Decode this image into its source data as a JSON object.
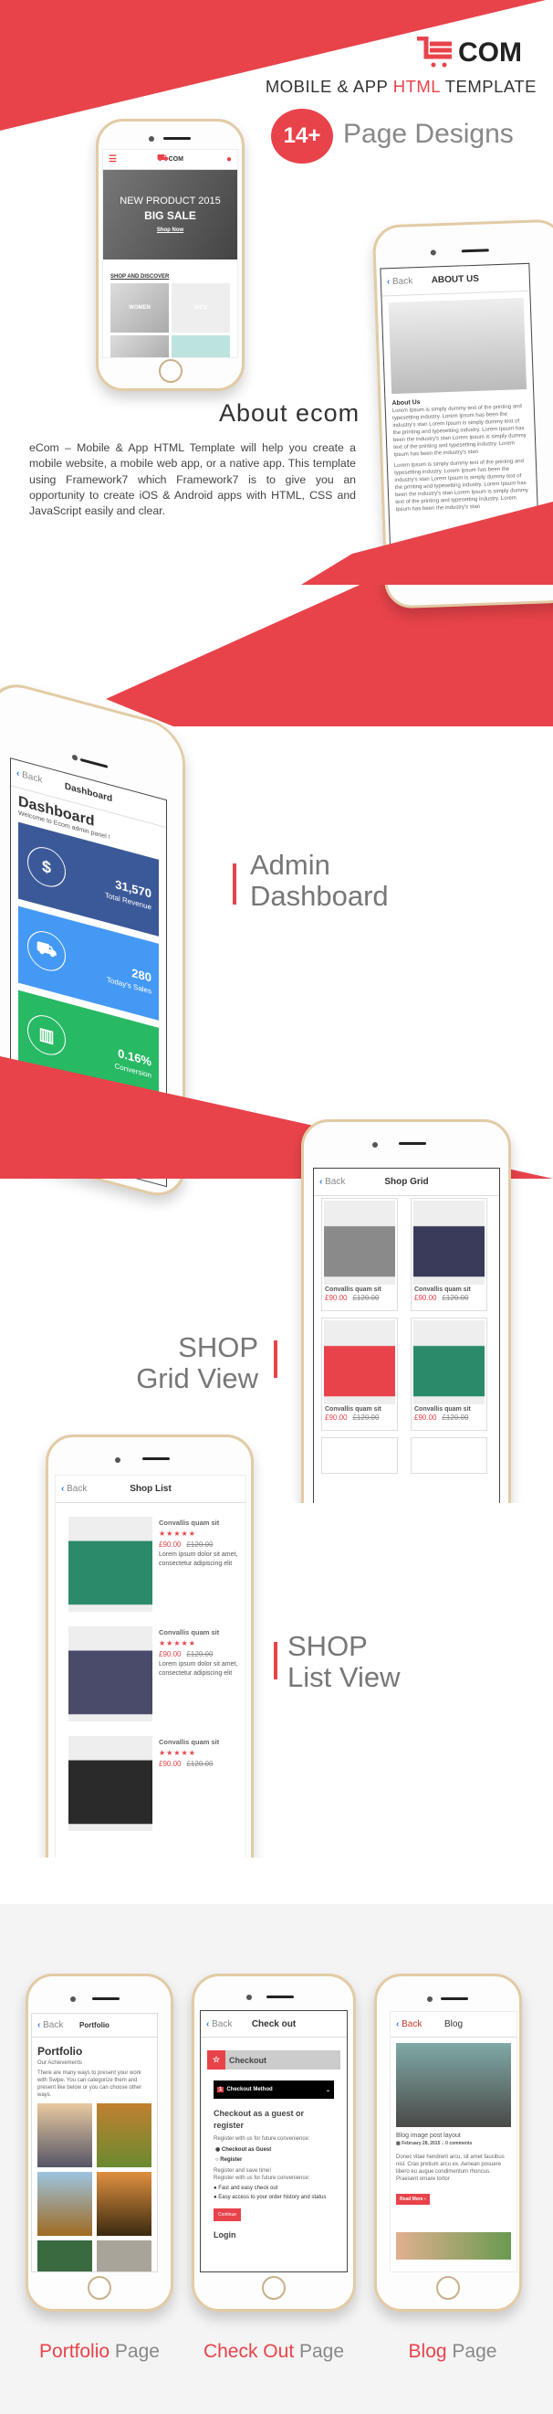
{
  "colors": {
    "accent": "#e8434a",
    "dark": "#222222",
    "blue": "#2a7bf5",
    "revenue": "#3b5998",
    "sales": "#4499f5",
    "conversion": "#28b964"
  },
  "logo": {
    "text": "COM",
    "icon": "cart-e-logo-icon"
  },
  "header": {
    "subtitle_pre": "MOBILE & APP ",
    "subtitle_accent": "HTML",
    "subtitle_post": " TEMPLATE",
    "badge": "14+",
    "badge_text": "Page Designs"
  },
  "home_phone": {
    "logo": "COM",
    "banner_line1": "NEW PRODUCT 2015",
    "banner_line2": "BIG SALE",
    "banner_button": "Shop Now",
    "section": "SHOP AND DISCOVER",
    "tiles": [
      "WOMEN",
      "MEN"
    ]
  },
  "about_phone": {
    "back": "Back",
    "title": "ABOUT US",
    "heading": "About Us",
    "para1": "Lorem Ipsum is simply dummy text of the printing and typesetting industry. Lorem Ipsum has been the industry's stan Lorem Ipsum is simply dummy text of the printing and typesetting industry. Lorem Ipsum has been the industry's stan Lorem Ipsum is simply dummy text of the printing and typesetting industry. Lorem Ipsum has been the industry's stan",
    "para2": "Lorem Ipsum is simply dummy text of the printing and typesetting industry. Lorem Ipsum has been the industry's stan Lorem Ipsum is simply dummy text of the printing and typesetting industry. Lorem Ipsum has been the industry's stan Lorem Ipsum is simply dummy text of the printing and typesetting industry. Lorem Ipsum has been the industry's stan"
  },
  "about": {
    "title": "About ecom",
    "text": "eCom – Mobile & App HTML Template will help you create a mobile website, a mobile web app, or a native app. This template using Framework7 which Framework7 is to give you an opportunity to create iOS & Android apps with HTML, CSS and JavaScript easily and clear."
  },
  "dashboard_phone": {
    "back": "Back",
    "title": "Dashboard",
    "heading": "Dashboard",
    "welcome": "Welcome to Ecom admin panel !",
    "stats": [
      {
        "value": "31,570",
        "label": "Total Revenue",
        "icon": "dollar-icon"
      },
      {
        "value": "280",
        "label": "Today's Sales",
        "icon": "cart-icon"
      },
      {
        "value": "0.16%",
        "label": "Conversion",
        "icon": "bar-chart-icon"
      }
    ]
  },
  "dashboard_label": {
    "line1": "Admin",
    "line2": "Dashboard"
  },
  "grid_phone": {
    "back": "Back",
    "title": "Shop Grid",
    "items": [
      {
        "name": "Convallis quam sit",
        "price": "£90.00",
        "old": "£120.00"
      },
      {
        "name": "Convallis quam sit",
        "price": "£90.00",
        "old": "£120.00"
      },
      {
        "name": "Convallis quam sit",
        "price": "£90.00",
        "old": "£120.00"
      },
      {
        "name": "Convallis quam sit",
        "price": "£90.00",
        "old": "£120.00"
      }
    ]
  },
  "grid_label": {
    "line1": "SHOP",
    "line2": "Grid View"
  },
  "list_phone": {
    "back": "Back",
    "title": "Shop List",
    "stars": "★★★★★",
    "items": [
      {
        "name": "Convallis quam sit",
        "price": "£90.00",
        "old": "£120.00",
        "desc": "Lorem ipsum dolor sit amet, consectetur adipiscing elit"
      },
      {
        "name": "Convallis quam sit",
        "price": "£90.00",
        "old": "£120.00",
        "desc": "Lorem ipsum dolor sit amet, consectetur adipiscing elit"
      },
      {
        "name": "Convallis quam sit",
        "price": "£90.00",
        "old": "£120.00"
      }
    ]
  },
  "list_label": {
    "line1": "SHOP",
    "line2": "List View"
  },
  "portfolio_phone": {
    "back": "Back",
    "title": "Portfolio",
    "heading": "Portfolio",
    "sub": "Our Achievements",
    "text": "There are many ways to present your work with Swipe. You can categorize them and present like below or you can choose other ways."
  },
  "checkout_phone": {
    "back": "Back",
    "title": "Check out",
    "panel": "Checkout",
    "step_num": "1",
    "step": "Checkout Method",
    "heading": "Checkout as a guest or register",
    "register_note": "Register with us for future convenience:",
    "opt1": "Checkout as Guest",
    "opt2": "Register",
    "save1": "Register and save time!",
    "save2": "Register with us for future convenience:",
    "bullet1": "Fast and easy check out",
    "bullet2": "Easy access to your order history and status",
    "button": "Continue",
    "login": "Login"
  },
  "blog_phone": {
    "back": "Back",
    "title": "Blog",
    "post_title": "Blog image post layout",
    "meta": "February 28, 2015 ⌂ 0 comments",
    "text": "Donec vitae hendrerit arcu, sit amet faucibus nisl. Cras pretium arcu ex. Aenean posuere libero eu augue condimentum rhoncus. Praesent ornare tortor",
    "button": "Read More ›"
  },
  "page_labels": [
    {
      "accent": "Portfolio",
      "rest": " Page"
    },
    {
      "accent": "Check Out",
      "rest": " Page"
    },
    {
      "accent": "Blog",
      "rest": " Page"
    }
  ]
}
